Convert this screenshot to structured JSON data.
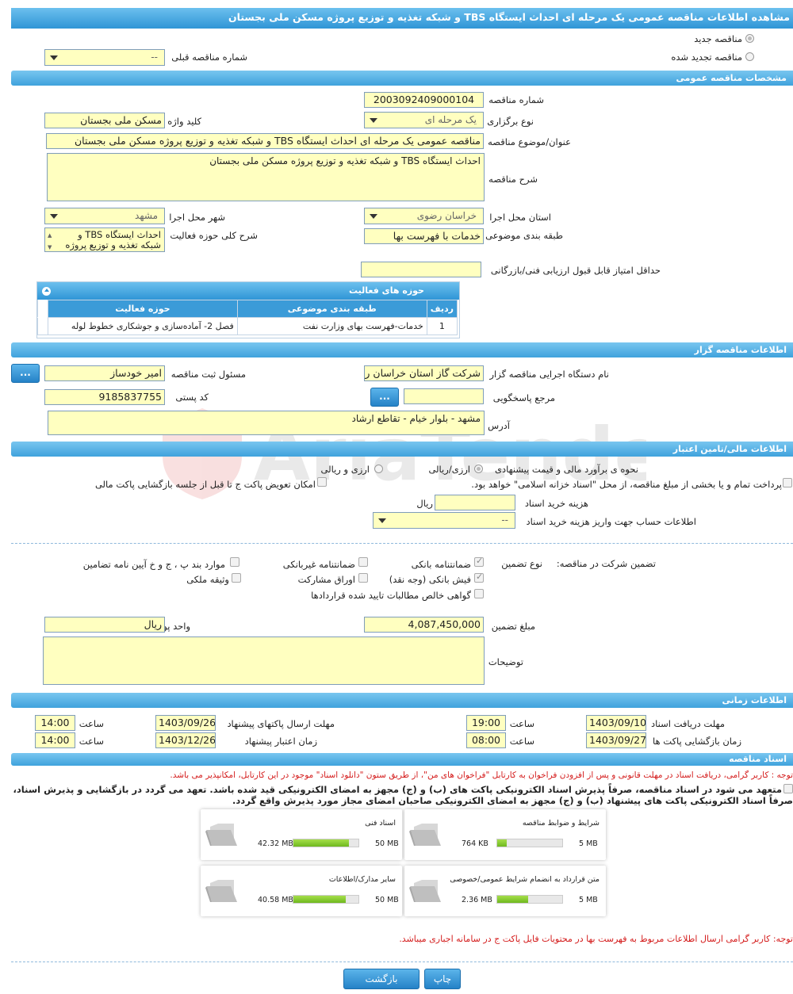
{
  "page_title": "مشاهده اطلاعات مناقصه عمومی یک مرحله ای احداث ایستگاه TBS و شبکه تغذیه و توزیع پروژه مسکن ملی بجستان",
  "tender_type": {
    "new_label": "مناقصه جدید",
    "renewed_label": "مناقصه تجدید شده",
    "selected": "new"
  },
  "prev_tender": {
    "label": "شماره مناقصه قبلی",
    "value": "--"
  },
  "sections": {
    "general": "مشخصات مناقصه عمومی",
    "organizer": "اطلاعات مناقصه گزار",
    "financial": "اطلاعات مالی/تامین اعتبار",
    "timing": "اطلاعات زمانی",
    "documents": "اسناد مناقصه"
  },
  "general": {
    "tender_number_label": "شماره مناقصه",
    "tender_number": "2003092409000104",
    "holding_type_label": "نوع برگزاری",
    "holding_type": "یک مرحله ای",
    "keyword_label": "کلید واژه",
    "keyword": "مسکن ملی بجستان",
    "subject_label": "عنوان/موضوع مناقصه",
    "subject": "مناقصه عمومی یک مرحله ای احداث ایستگاه TBS و شبکه تغذیه و توزیع پروژه مسکن ملی بجستان",
    "description_label": "شرح مناقصه",
    "description": "احداث ایستگاه TBS و شبکه تغذیه و توزیع پروژه مسکن ملی بجستان",
    "province_label": "استان محل اجرا",
    "province": "خراسان رضوی",
    "city_label": "شهر محل اجرا",
    "city": "مشهد",
    "category_label": "طبقه بندی موضوعی",
    "category": "خدمات با فهرست بها",
    "activity_desc_label": "شرح کلی حوزه فعالیت",
    "activity_desc": "احداث ایستگاه TBS و شبکه تغذیه و توزیع پروژه",
    "min_score_label": "حداقل امتیاز قابل قبول ارزیابی فنی/بازرگانی",
    "min_score": ""
  },
  "activities": {
    "title": "حوزه های فعالیت",
    "headers": [
      "ردیف",
      "طبقه بندی موضوعی",
      "حوزه فعالیت"
    ],
    "rows": [
      [
        "1",
        "خدمات-فهرست بهای وزارت نفت",
        "فصل 2- آماده‌سازی و جوشکاری خطوط لوله"
      ]
    ]
  },
  "organizer": {
    "org_label": "نام دستگاه اجرایی مناقصه گزار",
    "org": "شرکت گاز استان خراسان رضوی",
    "registrar_label": "مسئول ثبت مناقصه",
    "registrar": "امیر خودساز",
    "ref_label": "مرجع پاسخگویی",
    "ref": "",
    "postal_label": "کد پستی",
    "postal": "9185837755",
    "address_label": "آدرس",
    "address": "مشهد - بلوار خیام - تقاطع ارشاد",
    "more_button": "..."
  },
  "financial": {
    "estimate_label": "نحوه ی برآورد مالی و قیمت پیشنهادی",
    "opt_rial": "ارزی/ریالی",
    "opt_fx": "ارزی و ریالی",
    "treasury_label": "پرداخت تمام و یا بخشی از مبلغ مناقصه، از محل \"اسناد خزانه اسلامی\" خواهد بود.",
    "swap_label": "امکان تعویض پاکت ج تا قبل از جلسه بازگشایی پاکت مالی",
    "doc_cost_label": "هزینه خرید اسناد",
    "doc_cost": "",
    "doc_cost_unit": "ریال",
    "account_label": "اطلاعات حساب جهت واریز هزینه خرید اسناد",
    "account": "--"
  },
  "guarantee": {
    "label": "تضمین شرکت در مناقصه:",
    "type_label": "نوع تضمین",
    "options": [
      {
        "label": "ضمانتنامه بانکی",
        "checked": true
      },
      {
        "label": "ضمانتنامه غیربانکی",
        "checked": false
      },
      {
        "label": "موارد بند پ ، ج و خ آیین نامه تضامین",
        "checked": false
      },
      {
        "label": "فیش بانکی (وجه نقد)",
        "checked": true
      },
      {
        "label": "اوراق مشارکت",
        "checked": false
      },
      {
        "label": "وثیقه ملکی",
        "checked": false
      },
      {
        "label": "گواهی خالص مطالبات تایید شده قراردادها",
        "checked": false
      }
    ],
    "amount_label": "مبلغ تضمین",
    "amount": "4,087,450,000",
    "currency_label": "واحد پول",
    "currency": "ریال",
    "notes_label": "توضیحات",
    "notes": ""
  },
  "timing": {
    "receive_deadline_label": "مهلت دریافت اسناد",
    "receive_deadline": "1403/09/10",
    "time_label": "ساعت",
    "receive_time": "19:00",
    "submit_deadline_label": "مهلت ارسال پاکتهای پیشنهاد",
    "submit_deadline": "1403/09/26",
    "submit_time": "14:00",
    "opening_label": "زمان بازگشایی پاکت ها",
    "opening": "1403/09/27",
    "opening_time": "08:00",
    "validity_label": "زمان اعتبار پیشنهاد",
    "validity": "1403/12/26",
    "validity_time": "14:00"
  },
  "documents": {
    "notice1": "توجه : کاربر گرامی، دریافت اسناد در مهلت قانونی و پس از افزودن فراخوان به کارتابل \"فراخوان های من\"، از طریق ستون \"دانلود اسناد\" موجود در این کارتابل، امکانپذیر می باشد.",
    "commit1": "متعهد می شود در اسناد مناقصه، صرفاً پذیرش اسناد الکترونیکی پاکت های (ب) و (ج) مجهز به امضای الکترونیکی قید شده باشد. تعهد می گردد در بازگشایی و پذیرش اسناد،",
    "commit2": "صرفاً اسناد الکترونیکی پاکت های پیشنهاد (ب) و (ج) مجهز به امضای الکترونیکی صاحبان امضای مجاز مورد پذیرش واقع گردد.",
    "files": [
      {
        "title": "شرایط و ضوابط مناقصه",
        "size": "764 KB",
        "max": "5 MB",
        "fill": 0.15
      },
      {
        "title": "اسناد فنی",
        "size": "42.32 MB",
        "max": "50 MB",
        "fill": 0.85
      },
      {
        "title": "متن قرارداد به انضمام شرایط عمومی/خصوصی",
        "size": "2.36 MB",
        "max": "5 MB",
        "fill": 0.47
      },
      {
        "title": "سایر مدارک/اطلاعات",
        "size": "40.58 MB",
        "max": "50 MB",
        "fill": 0.81
      }
    ],
    "notice2": "توجه: کاربر گرامی ارسال اطلاعات مربوط به فهرست بها در محتویات فایل پاکت ج در سامانه اجباری میباشد."
  },
  "buttons": {
    "print": "چاپ",
    "back": "بازگشت"
  },
  "watermark": "AriaTender.neT"
}
